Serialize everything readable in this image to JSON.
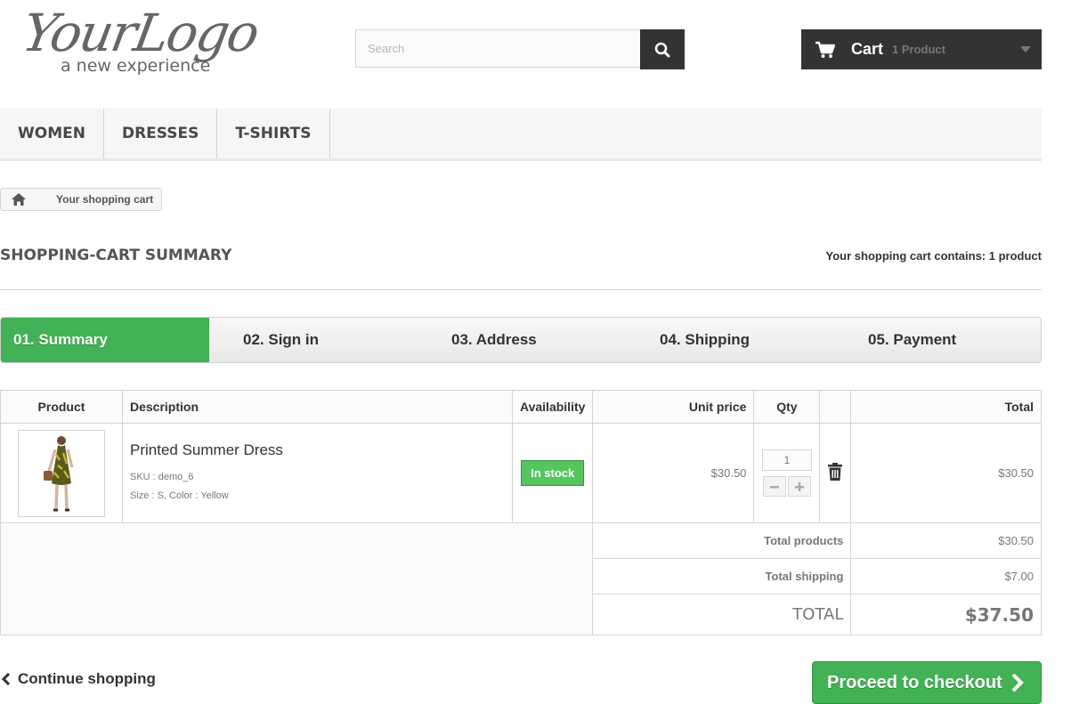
{
  "header": {
    "logo_main": "YourLogo",
    "logo_tagline": "a new experience",
    "search_placeholder": "Search",
    "cart_label": "Cart",
    "cart_count": "1 Product"
  },
  "menu": [
    "WOMEN",
    "DRESSES",
    "T-SHIRTS"
  ],
  "breadcrumb": {
    "current": "Your shopping cart"
  },
  "page": {
    "title": "SHOPPING-CART SUMMARY",
    "contains_prefix": "Your shopping cart contains:",
    "contains_count": "1 product"
  },
  "steps": [
    "01. Summary",
    "02. Sign in",
    "03. Address",
    "04. Shipping",
    "05. Payment"
  ],
  "table": {
    "headers": {
      "product": "Product",
      "description": "Description",
      "availability": "Availability",
      "unit_price": "Unit price",
      "qty": "Qty",
      "total": "Total"
    },
    "item": {
      "name": "Printed Summer Dress",
      "sku": "SKU : demo_6",
      "attributes": "Size : S, Color : Yellow",
      "availability": "In stock",
      "unit_price": "$30.50",
      "qty": "1",
      "total": "$30.50"
    },
    "summary": {
      "total_products_label": "Total products",
      "total_products": "$30.50",
      "total_shipping_label": "Total shipping",
      "total_shipping": "$7.00",
      "grand_total_label": "TOTAL",
      "grand_total": "$37.50"
    }
  },
  "actions": {
    "continue": "Continue shopping",
    "checkout": "Proceed to checkout"
  },
  "colors": {
    "accent_green": "#43b155",
    "dark": "#333333"
  }
}
